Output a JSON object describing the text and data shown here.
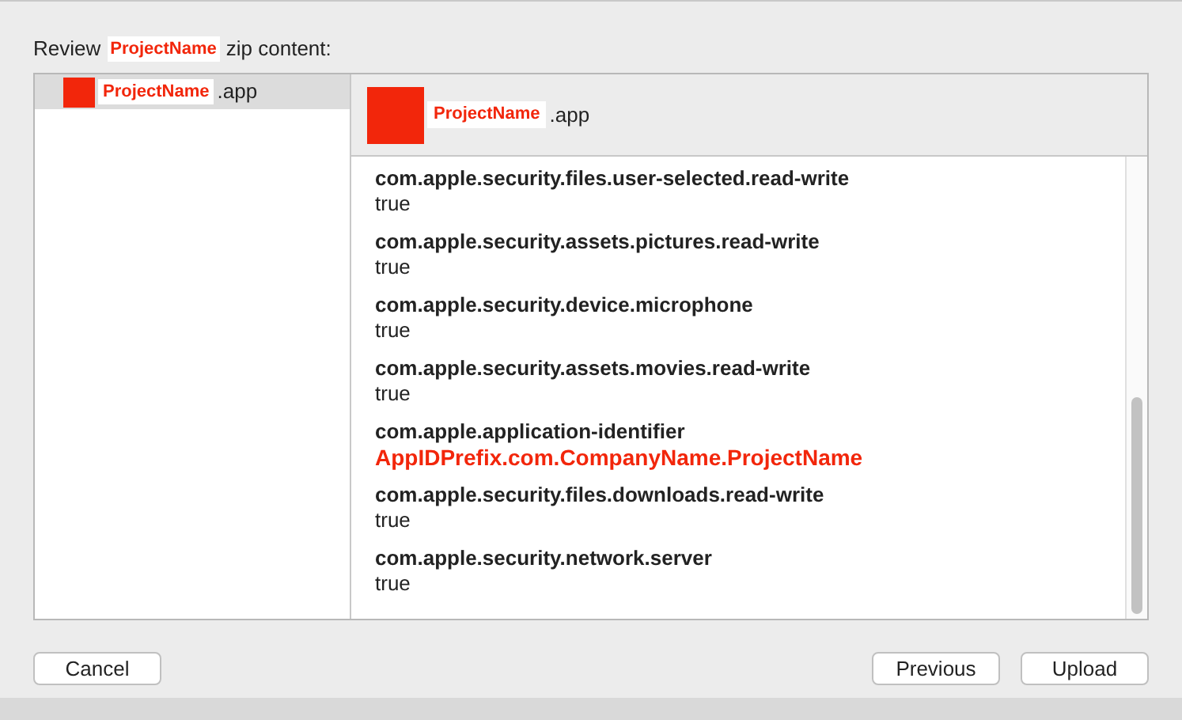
{
  "title": {
    "prefix": "Review",
    "redacted": "ProjectName",
    "suffix": "zip content:"
  },
  "sidebar": {
    "items": [
      {
        "name": "ProjectName",
        "suffix": ".app",
        "selected": true
      }
    ]
  },
  "detail": {
    "header": {
      "name": "ProjectName",
      "suffix": ".app"
    },
    "entries": [
      {
        "key": "com.apple.security.files.user-selected.read-write",
        "value": "true",
        "kind": "plain"
      },
      {
        "key": "com.apple.security.assets.pictures.read-write",
        "value": "true",
        "kind": "plain"
      },
      {
        "key": "com.apple.security.device.microphone",
        "value": "true",
        "kind": "plain"
      },
      {
        "key": "com.apple.security.assets.movies.read-write",
        "value": "true",
        "kind": "plain"
      },
      {
        "key": "com.apple.application-identifier",
        "value": "AppIDPrefix.com.CompanyName.ProjectName",
        "kind": "redacted"
      },
      {
        "key": "com.apple.security.files.downloads.read-write",
        "value": "true",
        "kind": "plain"
      },
      {
        "key": "com.apple.security.network.server",
        "value": "true",
        "kind": "plain"
      }
    ]
  },
  "buttons": {
    "left": [
      "Cancel"
    ],
    "right": [
      "Previous",
      "Upload"
    ]
  }
}
